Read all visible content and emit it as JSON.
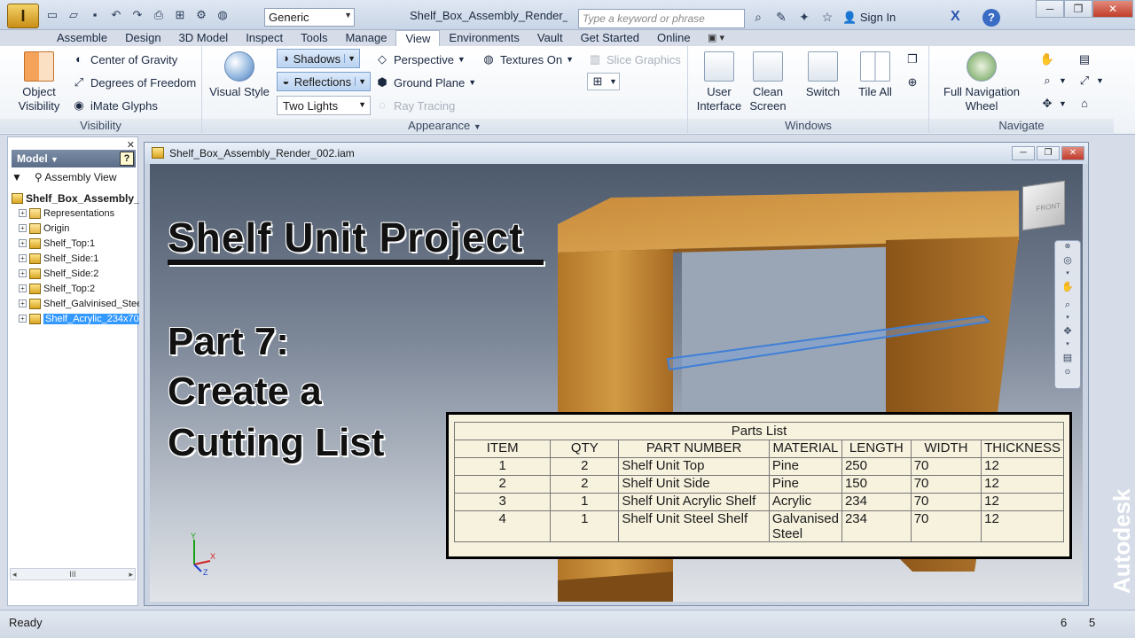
{
  "titlebar": {
    "app_button": "I",
    "visual_style": "Generic",
    "document_title": "Shelf_Box_Assembly_Render_...",
    "search_placeholder": "Type a keyword or phrase",
    "sign_in": "Sign In",
    "help": "?"
  },
  "tabs": [
    "Assemble",
    "Design",
    "3D Model",
    "Inspect",
    "Tools",
    "Manage",
    "View",
    "Environments",
    "Vault",
    "Get Started",
    "Online"
  ],
  "active_tab": "View",
  "ribbon": {
    "visibility": {
      "label": "Visibility",
      "object_visibility": "Object\nVisibility",
      "center_of_gravity": "Center of Gravity",
      "degrees_of_freedom": "Degrees of Freedom",
      "imate_glyphs": "iMate Glyphs"
    },
    "appearance": {
      "label": "Appearance",
      "visual_style": "Visual Style",
      "shadows": "Shadows",
      "reflections": "Reflections",
      "two_lights": "Two Lights",
      "perspective": "Perspective",
      "ground_plane": "Ground Plane",
      "ray_tracing": "Ray Tracing",
      "textures_on": "Textures On",
      "slice_graphics": "Slice Graphics"
    },
    "windows": {
      "label": "Windows",
      "user_interface": "User\nInterface",
      "clean_screen": "Clean\nScreen",
      "switch": "Switch",
      "tile_all": "Tile All"
    },
    "navigate": {
      "label": "Navigate",
      "full_navigation_wheel": "Full Navigation\nWheel"
    }
  },
  "browser": {
    "tab": "Model",
    "assembly_view": "Assembly View",
    "root": "Shelf_Box_Assembly_R",
    "nodes": [
      "Representations",
      "Origin",
      "Shelf_Top:1",
      "Shelf_Side:1",
      "Shelf_Side:2",
      "Shelf_Top:2",
      "Shelf_Galvinised_Stee",
      "Shelf_Acrylic_234x70"
    ],
    "selected_index": 7,
    "hscroll": "III"
  },
  "graphics": {
    "window_title": "Shelf_Box_Assembly_Render_002.iam",
    "viewcube_face": "FRONT"
  },
  "overlay": {
    "title": "Shelf Unit Project",
    "part": "Part 7:",
    "line2": "Create a",
    "line3": "Cutting List"
  },
  "parts_list": {
    "caption": "Parts List",
    "headers": [
      "ITEM",
      "QTY",
      "PART NUMBER",
      "MATERIAL",
      "LENGTH",
      "WIDTH",
      "THICKNESS"
    ],
    "rows": [
      [
        "1",
        "2",
        "Shelf Unit Top",
        "Pine",
        "250",
        "70",
        "12"
      ],
      [
        "2",
        "2",
        "Shelf Unit Side",
        "Pine",
        "150",
        "70",
        "12"
      ],
      [
        "3",
        "1",
        "Shelf Unit Acrylic Shelf",
        "Acrylic",
        "234",
        "70",
        "12"
      ],
      [
        "4",
        "1",
        "Shelf Unit Steel Shelf",
        "Galvanised Steel",
        "234",
        "70",
        "12"
      ]
    ]
  },
  "brand": "Autodesk",
  "status": {
    "text": "Ready",
    "count1": "6",
    "count2": "5"
  }
}
